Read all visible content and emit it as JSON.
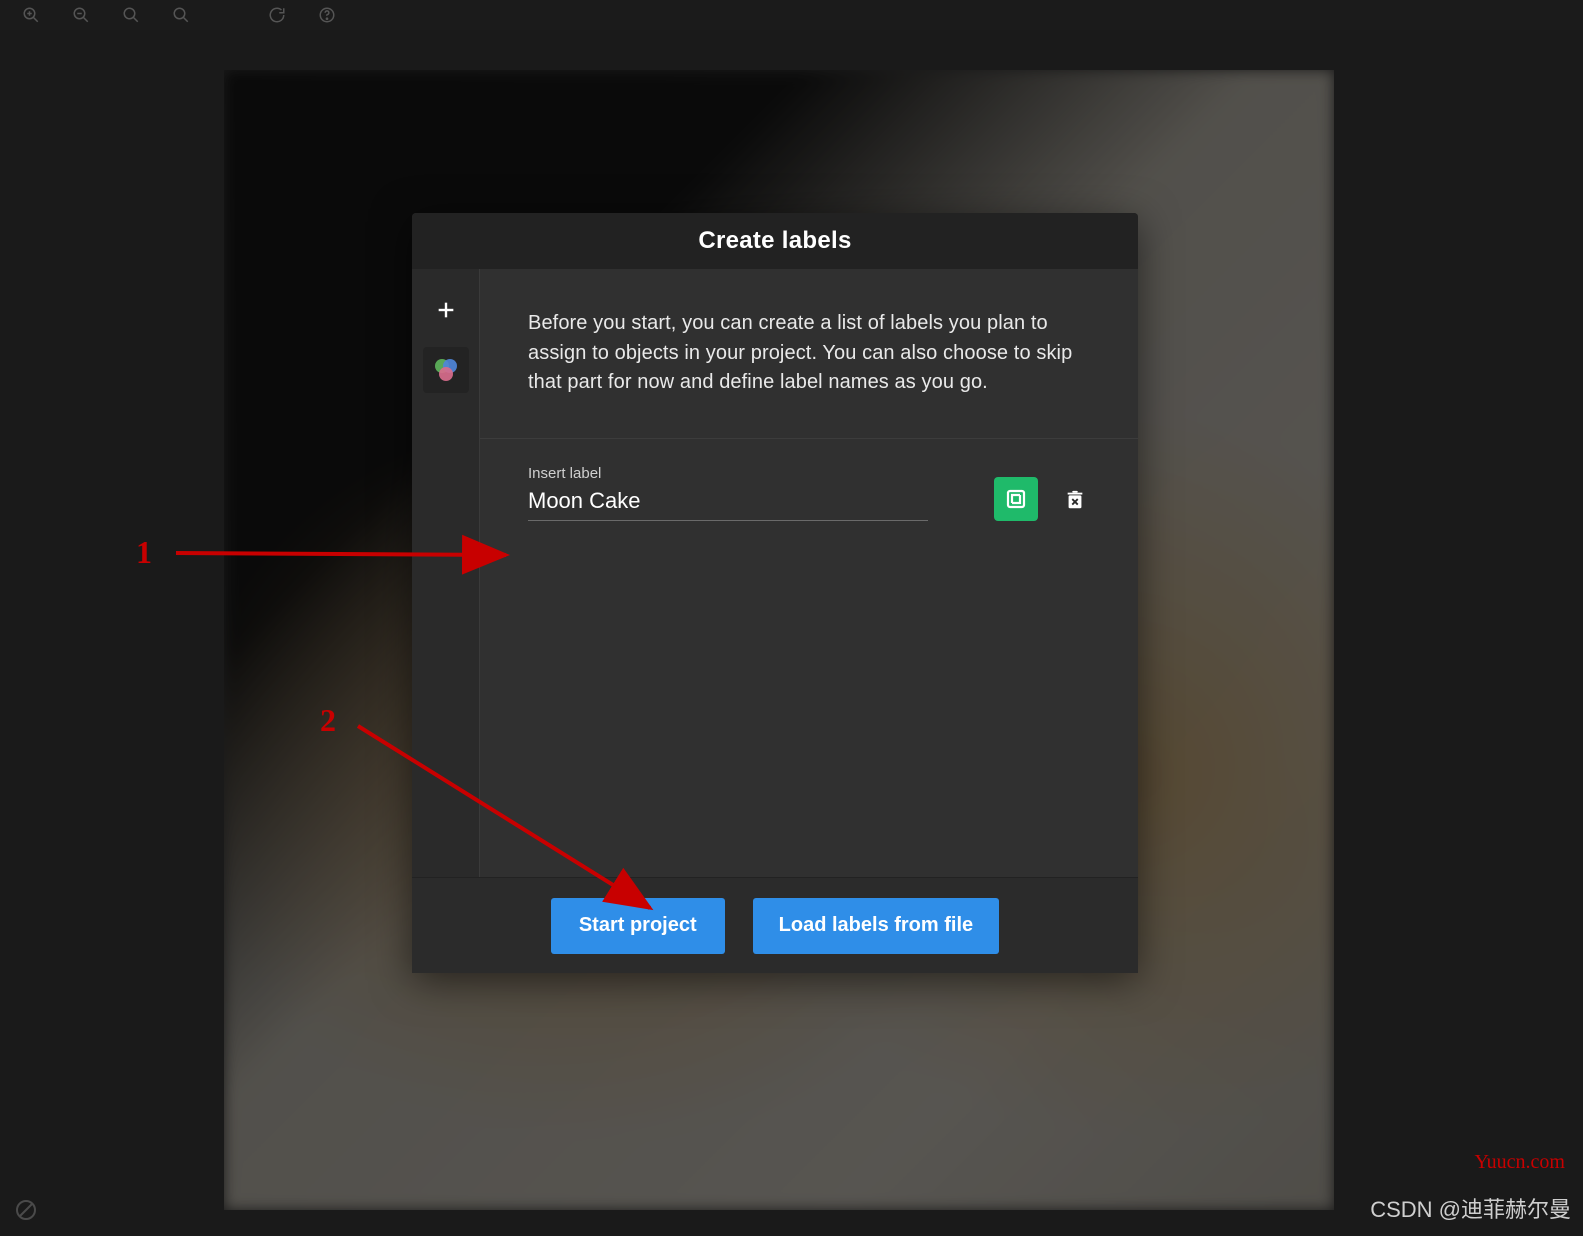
{
  "modal": {
    "title": "Create labels",
    "intro": "Before you start, you can create a list of labels you plan to assign to objects in your project. You can also choose to skip that part for now and define label names as you go.",
    "field_label": "Insert label",
    "label_value": "Moon Cake"
  },
  "buttons": {
    "start": "Start project",
    "load": "Load labels from file"
  },
  "side_rail": {
    "add": "plus-icon",
    "color": "color-wheel-icon"
  },
  "annotations": {
    "one": "1",
    "two": "2"
  },
  "watermarks": {
    "site": "Yuucn.com",
    "csdn": "CSDN @迪菲赫尔曼"
  },
  "colors": {
    "accent": "#2f8ee8",
    "green": "#1fba6a",
    "annotation": "#c80000"
  }
}
